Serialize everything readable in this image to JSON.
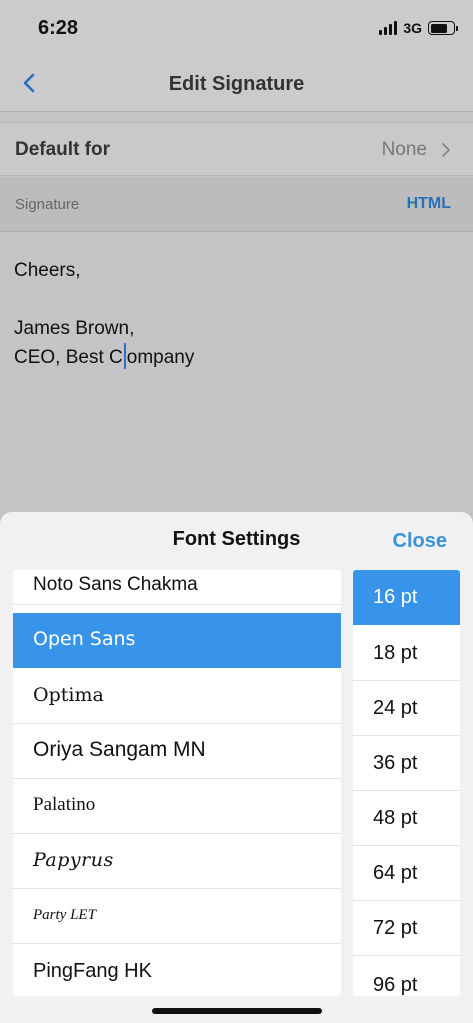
{
  "status_bar": {
    "time": "6:28",
    "network": "3G"
  },
  "nav": {
    "title": "Edit Signature",
    "back_icon": "chevron-left-icon"
  },
  "default_row": {
    "label": "Default for",
    "value": "None"
  },
  "signature_section": {
    "label": "Signature",
    "format_link": "HTML"
  },
  "editor": {
    "lines": [
      "Cheers,",
      "",
      "James Brown,"
    ],
    "last_line_before_caret": "CEO, Best C",
    "last_line_after_caret": "ompany"
  },
  "font_sheet": {
    "title": "Font Settings",
    "close_label": "Close",
    "fonts": [
      {
        "label": "Noto Sans Chakma"
      },
      {
        "label": "Open Sans"
      },
      {
        "label": "Optima"
      },
      {
        "label": "Oriya Sangam MN"
      },
      {
        "label": "Palatino"
      },
      {
        "label": "Papyrus"
      },
      {
        "label": "Party LET"
      },
      {
        "label": "PingFang HK"
      }
    ],
    "selected_font": "Open Sans",
    "sizes": [
      "16 pt",
      "18 pt",
      "24 pt",
      "36 pt",
      "48 pt",
      "64 pt",
      "72 pt",
      "96 pt"
    ],
    "selected_size": "16 pt"
  },
  "colors": {
    "accent": "#3794e8",
    "link": "#2a70b8",
    "caret": "#2a6fd6"
  }
}
